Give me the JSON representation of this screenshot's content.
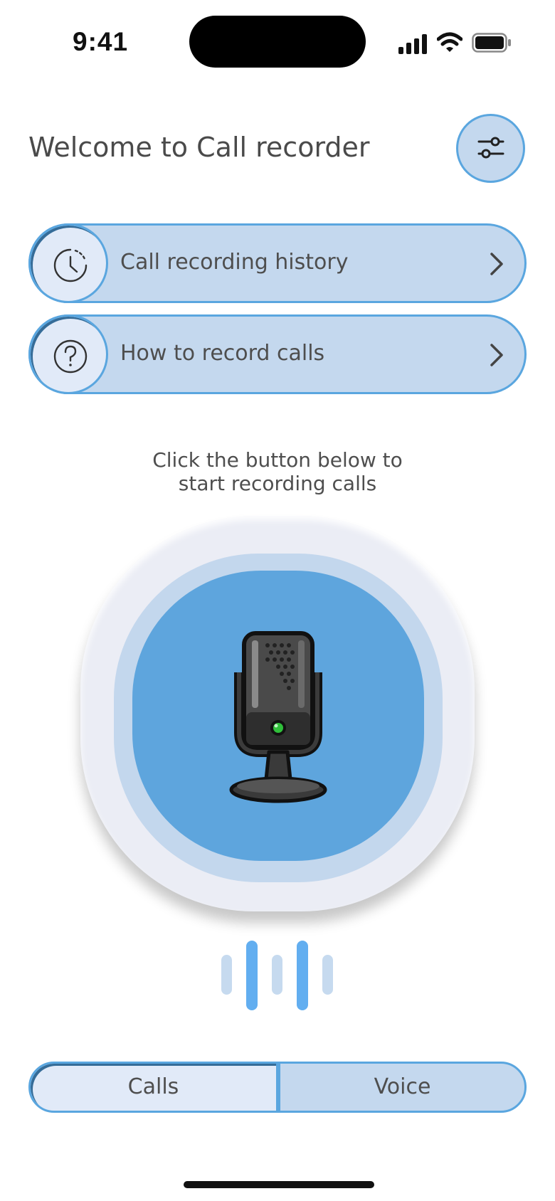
{
  "status_bar": {
    "time": "9:41",
    "icons": [
      "signal-icon",
      "wifi-icon",
      "battery-icon"
    ]
  },
  "header": {
    "title": "Welcome to Call recorder",
    "settings_icon": "sliders-icon"
  },
  "menu": [
    {
      "label": "Call recording history",
      "icon": "history-icon"
    },
    {
      "label": "How to record calls",
      "icon": "question-icon"
    }
  ],
  "instruction": {
    "line1": "Click the button below to",
    "line2": "start recording calls"
  },
  "record_button": {
    "icon": "microphone-icon"
  },
  "mode_switch": {
    "options": [
      "Calls",
      "Voice"
    ],
    "selected": "Calls"
  },
  "colors": {
    "accent": "#5aa6df",
    "pill_fill": "#c4d8ee",
    "circle_fill": "#e1eaf8",
    "record_inner": "#5ea5dd",
    "wave_active": "#62aef0",
    "wave_inactive": "#c6daef"
  }
}
